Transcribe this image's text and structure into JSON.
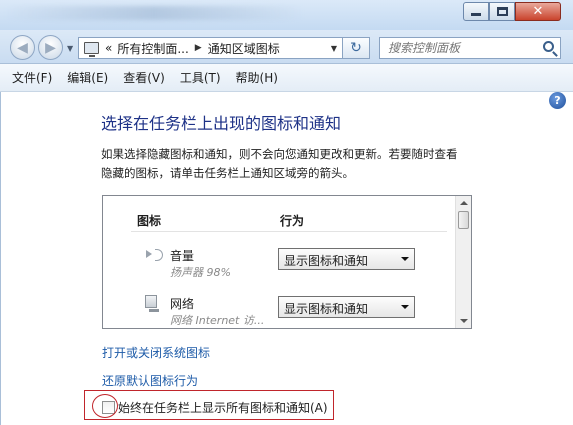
{
  "window": {
    "minimize_glyph": "",
    "maximize_glyph": "",
    "close_glyph": "✕"
  },
  "nav": {
    "back_glyph": "◀",
    "forward_glyph": "▶",
    "breadcrumb": [
      "«",
      "所有控制面...",
      "通知区域图标"
    ],
    "refresh_glyph": "↻",
    "search_placeholder": "搜索控制面板"
  },
  "menu": [
    "文件(F)",
    "编辑(E)",
    "查看(V)",
    "工具(T)",
    "帮助(H)"
  ],
  "page": {
    "help_glyph": "?",
    "title": "选择在任务栏上出现的图标和通知",
    "description": "如果选择隐藏图标和通知，则不会向您通知更改和更新。若要随时查看隐藏的图标，请单击任务栏上通知区域旁的箭头。"
  },
  "list": {
    "col_icon": "图标",
    "col_behavior": "行为",
    "rows": [
      {
        "icon": "speaker-icon",
        "name": "音量",
        "sub": "扬声器 98%",
        "behavior": "显示图标和通知"
      },
      {
        "icon": "network-icon",
        "name": "网络",
        "sub": "网络 Internet 访...",
        "behavior": "显示图标和通知"
      }
    ]
  },
  "links": {
    "system_icons": "打开或关闭系统图标",
    "restore_default": "还原默认图标行为"
  },
  "checkbox": {
    "label": "始终在任务栏上显示所有图标和通知(A)",
    "checked": false
  },
  "colors": {
    "title": "#1e3287",
    "link": "#1d5ba8",
    "highlight": "#c0252b"
  }
}
